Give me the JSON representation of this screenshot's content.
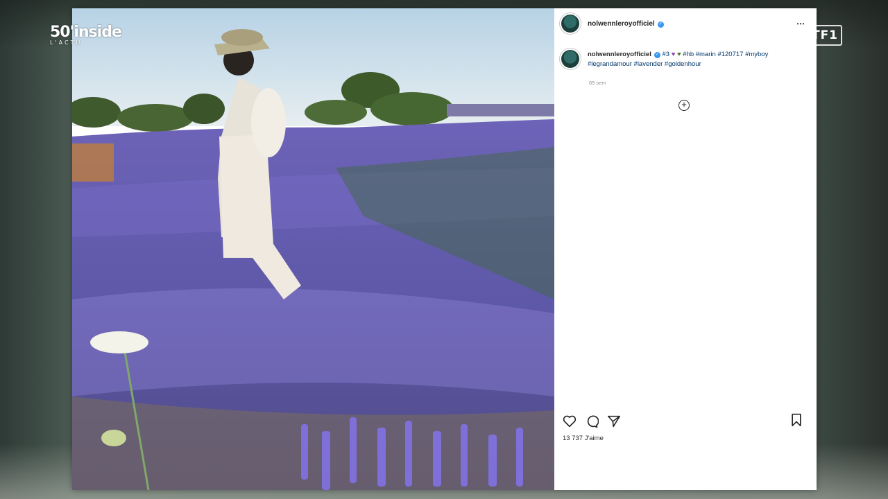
{
  "tv": {
    "show_logo": "50'inside",
    "show_logo_sub": "L'ACTU",
    "channel": "TF1"
  },
  "post": {
    "username": "nolwennleroyofficiel",
    "verified": true,
    "more_icon": "⋯",
    "caption": {
      "username": "nolwennleroyofficiel",
      "prefix": "#3",
      "emoji_1": "♥",
      "emoji_2": "♥",
      "hashtags_line1": "#hb #marin #120717 #myboy",
      "hashtags_line2": "#legrandamour #lavender #goldenhour"
    },
    "timestamp": "69 sem",
    "add_comment_icon": "+",
    "actions": {
      "like_icon": "heart-icon",
      "comment_icon": "comment-icon",
      "share_icon": "share-icon",
      "save_icon": "bookmark-icon"
    },
    "likes": "13 737 J'aime"
  },
  "colors": {
    "lavender": "#6a5fb5",
    "sky": "#cfe3ef",
    "link": "#00376b",
    "verified": "#3897f0"
  }
}
